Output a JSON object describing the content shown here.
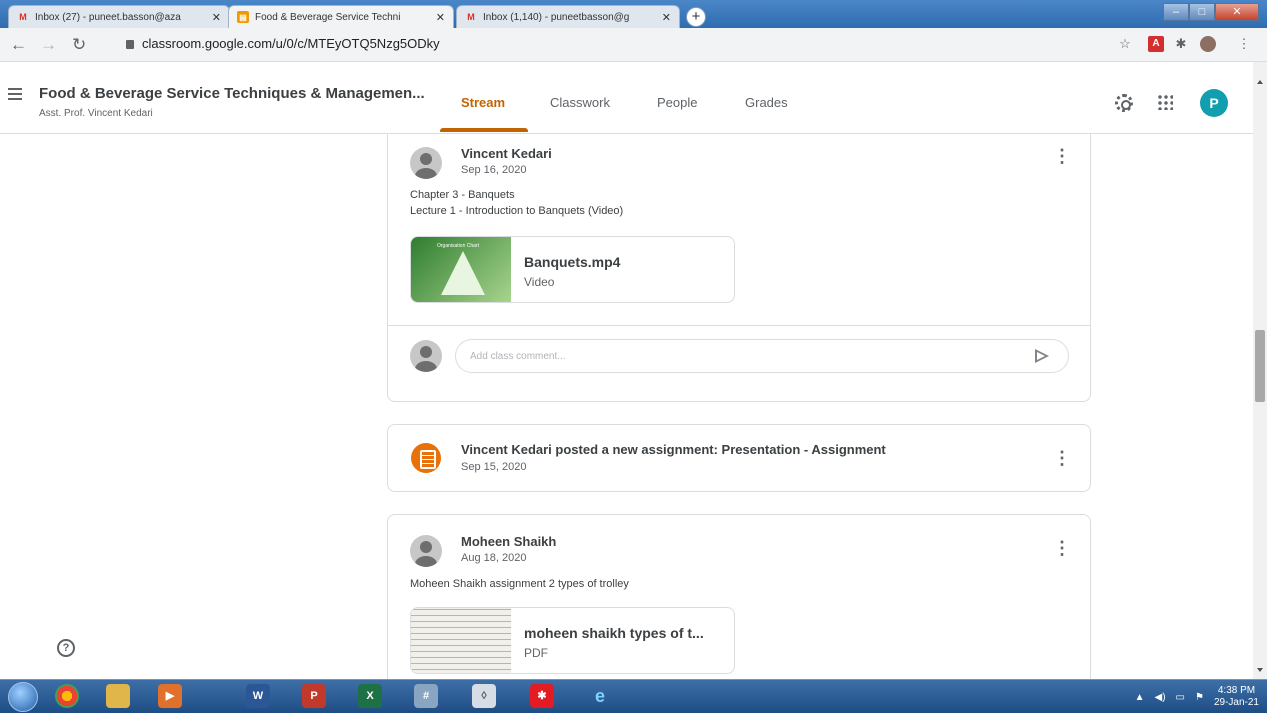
{
  "browser": {
    "tabs": [
      {
        "title": "Inbox (27) - puneet.basson@aza",
        "favicon": "gmail-icon"
      },
      {
        "title": "Food & Beverage Service Techni",
        "favicon": "classroom-icon",
        "active": true
      },
      {
        "title": "Inbox (1,140) - puneetbasson@g",
        "favicon": "gmail-icon"
      }
    ],
    "new_tab_label": "+",
    "url": "classroom.google.com/u/0/c/MTEyOTQ5Nzg5ODky"
  },
  "header": {
    "class_title": "Food & Beverage Service Techniques & Managemen...",
    "teacher": "Asst. Prof. Vincent Kedari",
    "tabs": [
      "Stream",
      "Classwork",
      "People",
      "Grades"
    ],
    "active_tab": "Stream",
    "user_initial": "P"
  },
  "stream": {
    "posts": [
      {
        "author": "Vincent Kedari",
        "date": "Sep 16, 2020",
        "lines": [
          "Chapter 3 - Banquets",
          "Lecture 1 - Introduction to Banquets (Video)"
        ],
        "thumbnail_title": "Organisation Chart",
        "attachment": {
          "name": "Banquets.mp4",
          "type": "Video"
        },
        "comment_placeholder": "Add class comment..."
      },
      {
        "title": "Vincent Kedari posted a new assignment: Presentation - Assignment",
        "date": "Sep 15, 2020"
      },
      {
        "author": "Moheen Shaikh",
        "date": "Aug 18, 2020",
        "lines": [
          "Moheen Shaikh assignment 2 types of trolley"
        ],
        "attachment": {
          "name": "moheen shaikh types of t...",
          "type": "PDF"
        }
      }
    ]
  },
  "help_label": "?",
  "taskbar": {
    "time": "4:38 PM",
    "date": "29-Jan-21"
  },
  "colors": {
    "accent": "#c26401",
    "assignment_icon": "#e8710a",
    "avatar": "#129eaf"
  }
}
